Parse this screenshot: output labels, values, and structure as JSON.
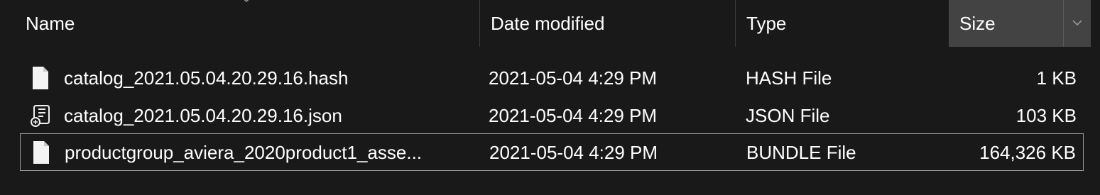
{
  "columns": {
    "name": "Name",
    "date_modified": "Date modified",
    "type": "Type",
    "size": "Size"
  },
  "sort": {
    "column": "name",
    "icon": "sort-indicator-icon"
  },
  "files": [
    {
      "name": "catalog_2021.05.04.20.29.16.hash",
      "date_modified": "2021-05-04 4:29 PM",
      "type": "HASH File",
      "size": "1 KB",
      "icon": "document-icon"
    },
    {
      "name": "catalog_2021.05.04.20.29.16.json",
      "date_modified": "2021-05-04 4:29 PM",
      "type": "JSON File",
      "size": "103 KB",
      "icon": "script-file-icon"
    },
    {
      "name": "productgroup_aviera_2020product1_asse...",
      "date_modified": "2021-05-04 4:29 PM",
      "type": "BUNDLE File",
      "size": "164,326 KB",
      "icon": "document-icon"
    }
  ],
  "colors": {
    "background": "#191919",
    "text": "#ffffff",
    "active_column_header": "#434343",
    "focus_border": "#9a9a9a"
  }
}
